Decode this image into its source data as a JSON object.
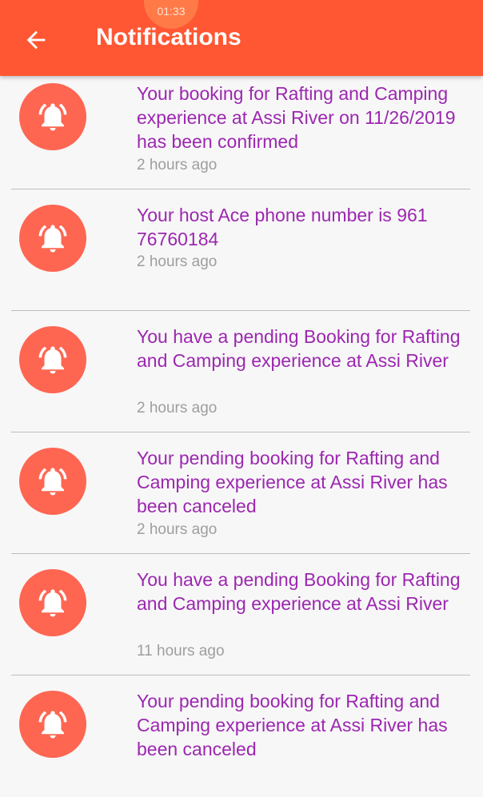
{
  "status_bar": {
    "time": "01:33"
  },
  "header": {
    "title": "Notifications",
    "back_icon": "arrow-back-icon"
  },
  "colors": {
    "appbar": "#ff5733",
    "accent_text": "#9c27b0",
    "avatar": "#fe6652"
  },
  "notifications": [
    {
      "message": "Your booking for Rafting and Camping experience at Assi River on 11/26/2019 has been confirmed",
      "time": "2 hours ago",
      "icon": "bell-ringing-icon"
    },
    {
      "message": "Your host Ace phone number is 961 76760184",
      "time": "2 hours ago",
      "icon": "bell-ringing-icon"
    },
    {
      "message": "You have a pending Booking for Rafting and Camping experience at Assi River",
      "time": "2 hours ago",
      "icon": "bell-ringing-icon"
    },
    {
      "message": "Your pending booking for Rafting and Camping experience at Assi River has been canceled",
      "time": "2 hours ago",
      "icon": "bell-ringing-icon"
    },
    {
      "message": "You have a pending Booking for Rafting and Camping experience at Assi River",
      "time": "11 hours ago",
      "icon": "bell-ringing-icon"
    },
    {
      "message": "Your pending booking for Rafting and Camping experience at Assi River has been canceled",
      "time": "",
      "icon": "bell-ringing-icon"
    }
  ]
}
